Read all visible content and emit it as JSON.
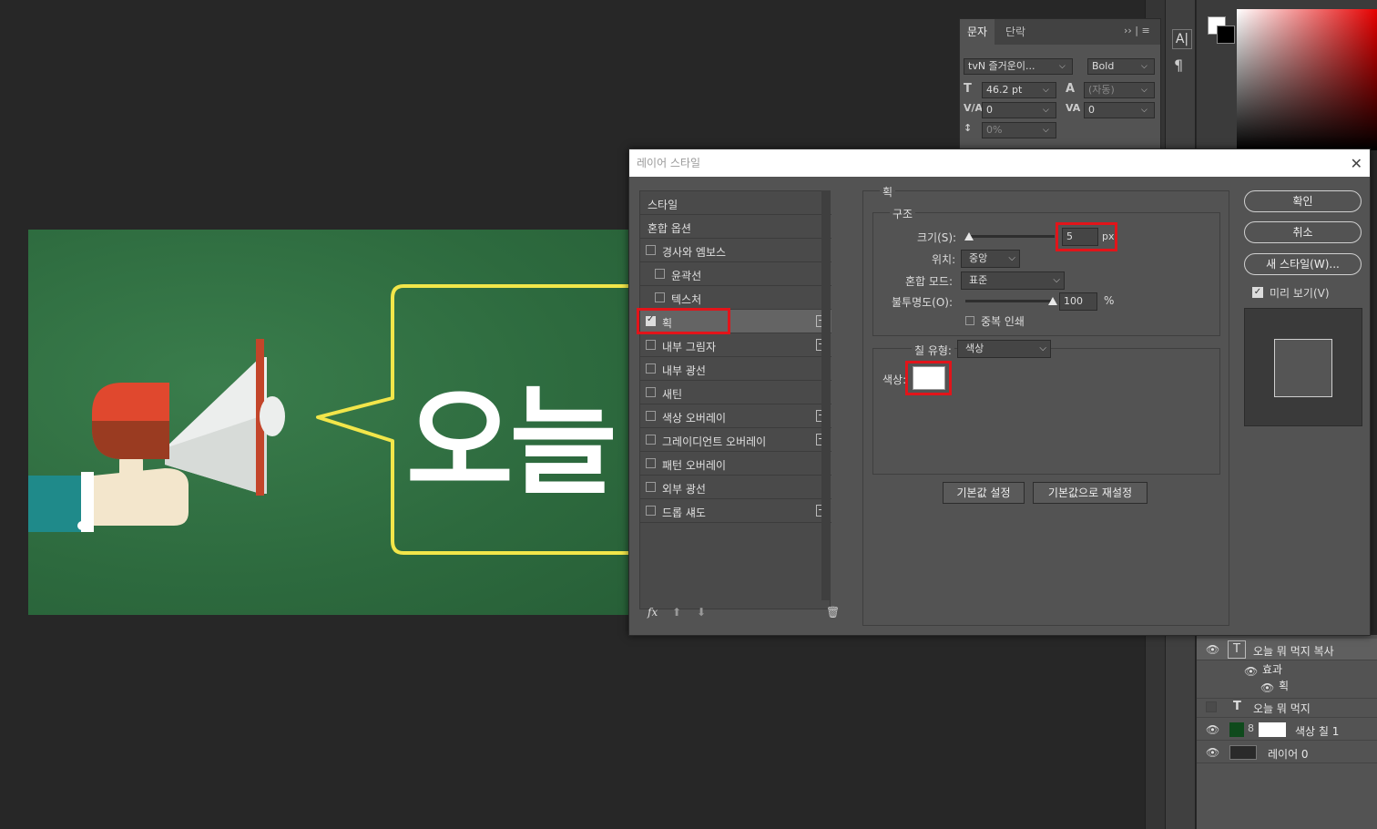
{
  "character_panel": {
    "tabs": [
      "문자",
      "단락"
    ],
    "font_family": "tvN 즐거운이...",
    "font_style": "Bold",
    "font_size": "46.2 pt",
    "leading": "(자동)",
    "kerning": "0",
    "tracking": "0",
    "scale": "0%"
  },
  "canvas": {
    "headline": "오늘 뭐"
  },
  "dialog": {
    "title": "레이어 스타일",
    "styles": [
      {
        "label": "스타일",
        "checkbox": false,
        "checked": false,
        "plus": false
      },
      {
        "label": "혼합 옵션",
        "checkbox": false,
        "checked": false,
        "plus": false
      },
      {
        "label": "경사와 엠보스",
        "checkbox": true,
        "checked": false,
        "plus": false
      },
      {
        "label": "윤곽선",
        "checkbox": true,
        "checked": false,
        "plus": false,
        "indent": true
      },
      {
        "label": "텍스처",
        "checkbox": true,
        "checked": false,
        "plus": false,
        "indent": true
      },
      {
        "label": "획",
        "checkbox": true,
        "checked": true,
        "plus": true,
        "selected": true
      },
      {
        "label": "내부 그림자",
        "checkbox": true,
        "checked": false,
        "plus": true
      },
      {
        "label": "내부 광선",
        "checkbox": true,
        "checked": false,
        "plus": false
      },
      {
        "label": "새틴",
        "checkbox": true,
        "checked": false,
        "plus": false
      },
      {
        "label": "색상 오버레이",
        "checkbox": true,
        "checked": false,
        "plus": true
      },
      {
        "label": "그레이디언트 오버레이",
        "checkbox": true,
        "checked": false,
        "plus": true
      },
      {
        "label": "패턴 오버레이",
        "checkbox": true,
        "checked": false,
        "plus": false
      },
      {
        "label": "외부 광선",
        "checkbox": true,
        "checked": false,
        "plus": false
      },
      {
        "label": "드롭 섀도",
        "checkbox": true,
        "checked": false,
        "plus": true
      }
    ],
    "stroke": {
      "section": "획",
      "structure": "구조",
      "size_label": "크기(S):",
      "size_value": "5",
      "size_unit": "px",
      "position_label": "위치:",
      "position_value": "중앙",
      "blend_label": "혼합 모드:",
      "blend_value": "표준",
      "opacity_label": "불투명도(O):",
      "opacity_value": "100",
      "opacity_unit": "%",
      "overprint_label": "중복 인쇄",
      "fill_type_label": "칠 유형:",
      "fill_type_value": "색상",
      "color_label": "색상:",
      "color_value": "#ffffff",
      "make_default": "기본값 설정",
      "reset_default": "기본값으로 재설정"
    },
    "buttons": {
      "ok": "확인",
      "cancel": "취소",
      "new_style": "새 스타일(W)...",
      "preview": "미리 보기(V)"
    }
  },
  "layers": [
    {
      "name": "오늘 뭐 먹지 복사",
      "visible": true,
      "type": "text"
    },
    {
      "name": "효과",
      "visible": true,
      "type": "effects"
    },
    {
      "name": "획",
      "visible": true,
      "type": "effect"
    },
    {
      "name": "오늘 뭐 먹지",
      "visible": false,
      "type": "text"
    },
    {
      "name": "색상 칠 1",
      "visible": true,
      "type": "fill"
    },
    {
      "name": "레이어 0",
      "visible": true,
      "type": "image"
    }
  ],
  "colors": {
    "highlight_red": "#e2141a",
    "canvas_green": "#2f7040",
    "chalk_yellow": "#f2e64a"
  }
}
